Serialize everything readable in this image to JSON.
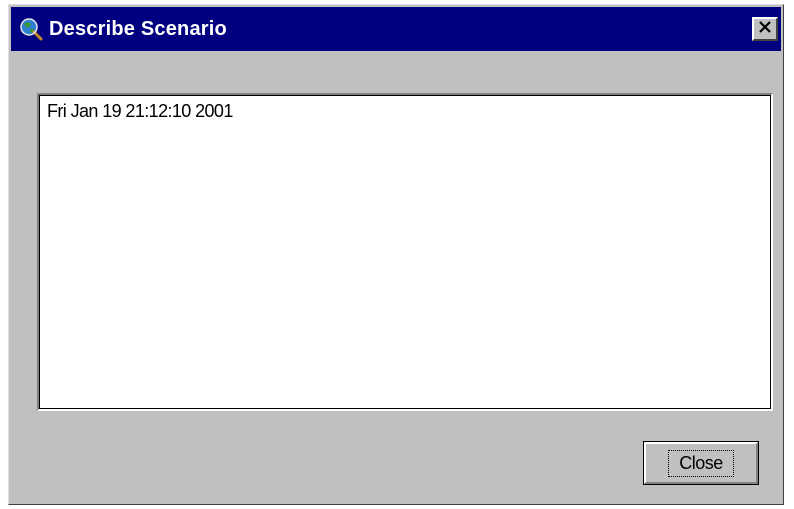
{
  "window": {
    "title": "Describe Scenario",
    "icon": "globe-magnifier-icon",
    "close_glyph": "✕"
  },
  "description": {
    "text": "Fri Jan 19 21:12:10 2001"
  },
  "buttons": {
    "close_label": "Close"
  },
  "colors": {
    "titlebar": "#000080",
    "face": "#c0c0c0"
  }
}
